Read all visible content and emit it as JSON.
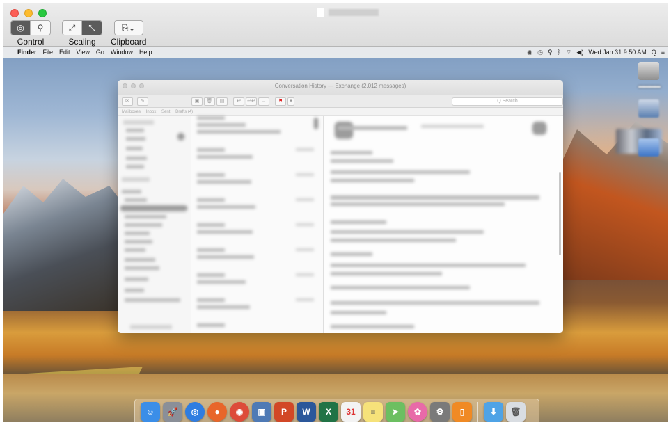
{
  "viewer": {
    "window_title": "",
    "toolbar": {
      "control": {
        "label": "Control",
        "buttons": [
          "target-icon",
          "binoculars-icon"
        ]
      },
      "scaling": {
        "label": "Scaling",
        "buttons": [
          "expand-arrows-icon",
          "shrink-arrows-icon"
        ]
      },
      "clipboard": {
        "label": "Clipboard",
        "buttons": [
          "clipboard-icon"
        ],
        "dropdown_glyph": "⌄"
      }
    }
  },
  "menubar": {
    "apple_glyph": "",
    "items": [
      "Finder",
      "File",
      "Edit",
      "View",
      "Go",
      "Window",
      "Help"
    ],
    "clock": "Wed Jan 31  9:50 AM",
    "status_icons": [
      "record-icon",
      "time-machine-icon",
      "binoculars-icon",
      "bluetooth-icon",
      "wifi-icon",
      "volume-icon"
    ],
    "search_glyph": "Q",
    "list_glyph": "≡"
  },
  "outlook": {
    "title": "Conversation History — Exchange (2,012 messages)",
    "search_placeholder": "Q  Search",
    "favorites": [
      "Mailboxes",
      "Inbox",
      "Sent",
      "Drafts (4)"
    ]
  },
  "dock": {
    "apps": [
      {
        "name": "Finder",
        "color": "#3b8ee8",
        "glyph": "☺"
      },
      {
        "name": "Launchpad",
        "color": "#8a8f98",
        "glyph": "🚀"
      },
      {
        "name": "Safari",
        "color": "#2f7de1",
        "glyph": "◎"
      },
      {
        "name": "Firefox",
        "color": "#e8662a",
        "glyph": "●"
      },
      {
        "name": "Chrome",
        "color": "#dd4b39",
        "glyph": "◉"
      },
      {
        "name": "Preview",
        "color": "#4f7ab5",
        "glyph": "▣"
      },
      {
        "name": "PowerPoint",
        "color": "#d24726",
        "glyph": "P"
      },
      {
        "name": "Word",
        "color": "#2b579a",
        "glyph": "W"
      },
      {
        "name": "Excel",
        "color": "#217346",
        "glyph": "X"
      },
      {
        "name": "Calendar",
        "color": "#f3f3f3",
        "glyph": "31"
      },
      {
        "name": "Notes",
        "color": "#f6e27a",
        "glyph": "≡"
      },
      {
        "name": "Maps",
        "color": "#6cbf61",
        "glyph": "➤"
      },
      {
        "name": "Photos",
        "color": "#e86aa8",
        "glyph": "✿"
      },
      {
        "name": "System Preferences",
        "color": "#7a7a7a",
        "glyph": "⚙"
      },
      {
        "name": "iBooks",
        "color": "#f08a24",
        "glyph": "▯"
      },
      {
        "name": "Downloads",
        "color": "#4fa3e6",
        "glyph": "⬇"
      },
      {
        "name": "Trash",
        "color": "#d9dde2",
        "glyph": "🗑"
      }
    ]
  }
}
